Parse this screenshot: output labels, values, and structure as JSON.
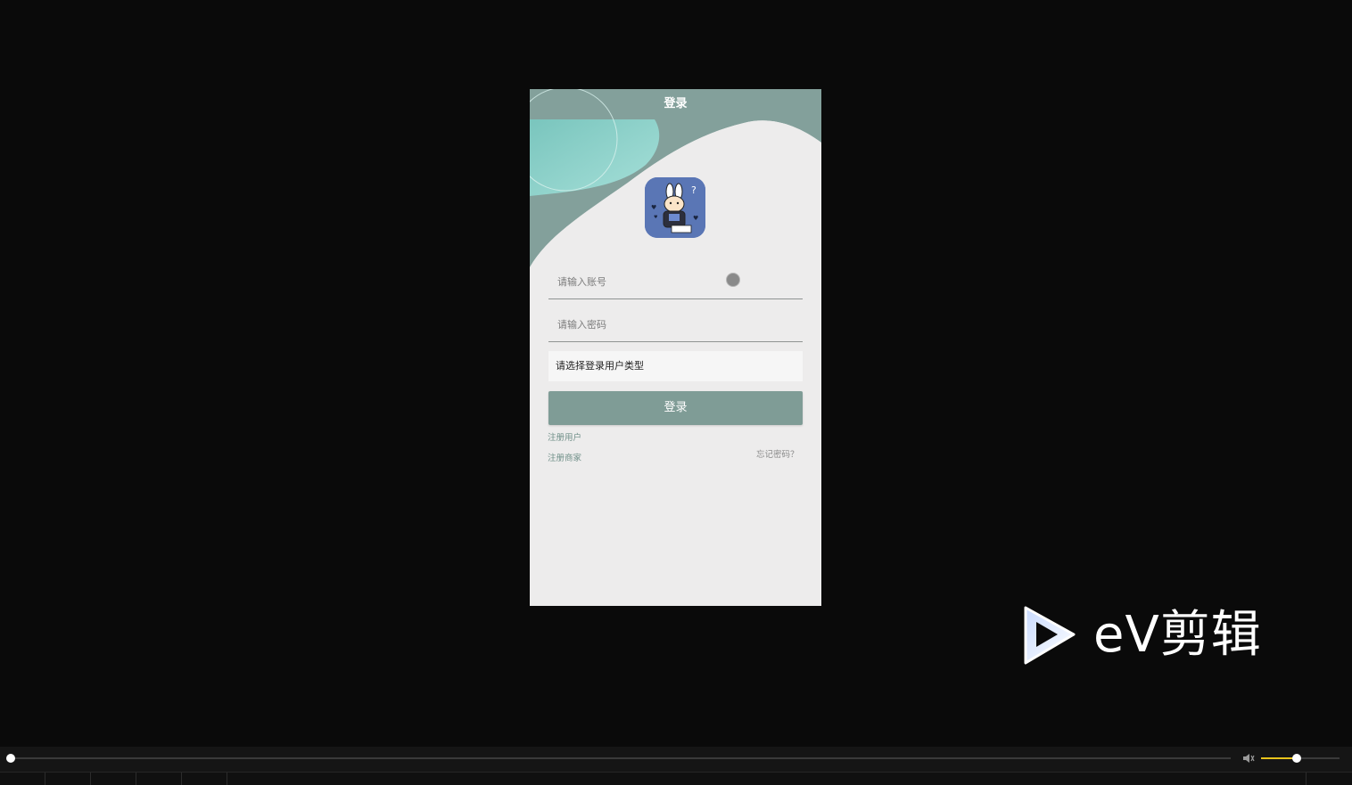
{
  "app": {
    "title": "登录"
  },
  "login_form": {
    "account_placeholder": "请输入账号",
    "password_placeholder": "请输入密码",
    "user_type_select": "请选择登录用户类型",
    "login_button": "登录",
    "register_user_link": "注册用户",
    "register_merchant_link": "注册商家",
    "forgot_password_link": "忘记密码？"
  },
  "watermark": {
    "text": "eV剪辑"
  },
  "player": {
    "seek_progress": 0.0,
    "volume_level": 0.45,
    "accent_color": "#e8c31b"
  },
  "colors": {
    "header": "#83a09b",
    "button": "#7f9c96",
    "link": "#6f8f88",
    "page_background": "#edecec"
  },
  "icons": {
    "logo": "bunny-avatar-icon",
    "watermark": "play-triangle-icon",
    "volume": "speaker-icon"
  }
}
